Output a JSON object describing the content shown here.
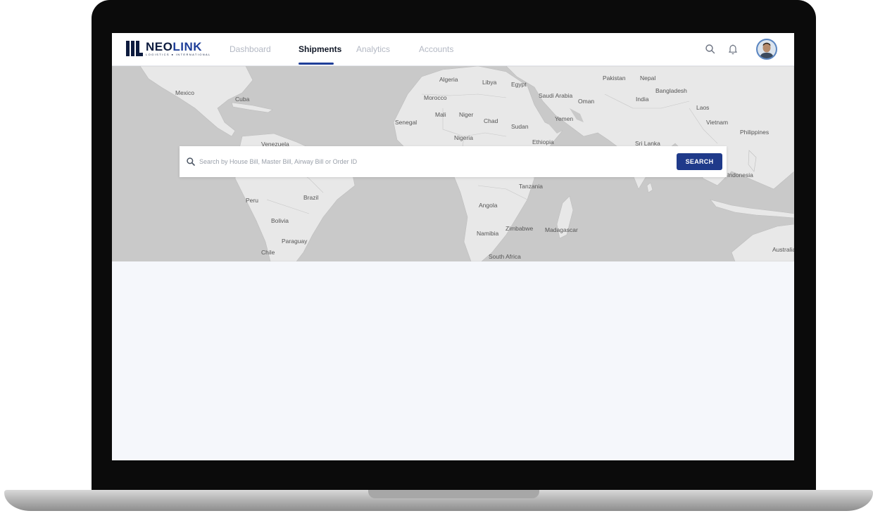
{
  "app": {
    "logo_text_neo": "NEO",
    "logo_text_link": "LINK",
    "logo_tagline": "LOGISTICS ● INTERNATIONAL"
  },
  "nav": {
    "items": [
      {
        "label": "Dashboard",
        "active": false
      },
      {
        "label": "Shipments",
        "active": true
      },
      {
        "label": "Analytics",
        "active": false
      },
      {
        "label": "Accounts",
        "active": false
      }
    ]
  },
  "header_icons": [
    "search-icon",
    "bell-icon",
    "user-avatar"
  ],
  "search": {
    "placeholder": "Search by House Bill, Master Bill, Airway Bill or Order ID",
    "value": "",
    "button_label": "SEARCH"
  },
  "map": {
    "labels": [
      "Mexico",
      "Cuba",
      "Venezuela",
      "Peru",
      "Brazil",
      "Bolivia",
      "Paraguay",
      "Chile",
      "Algeria",
      "Libya",
      "Egypt",
      "Senegal",
      "Mali",
      "Niger",
      "Chad",
      "Sudan",
      "Nigeria",
      "Ethiopia",
      "Tanzania",
      "Angola",
      "Namibia",
      "Zimbabwe",
      "Madagascar",
      "South Africa",
      "Saudi Arabia",
      "Oman",
      "Yemen",
      "Pakistan",
      "Nepal",
      "India",
      "Bangladesh",
      "Laos",
      "Vietnam",
      "Philippines",
      "Sri Lanka",
      "Indonesia",
      "Australia",
      "Morocco"
    ]
  },
  "colors": {
    "brand_navy": "#0d1b3e",
    "brand_blue": "#1f3a8a",
    "nav_inactive": "#b4b9c4",
    "map_water": "#c9c9c9",
    "map_land": "#e8e8e8"
  }
}
